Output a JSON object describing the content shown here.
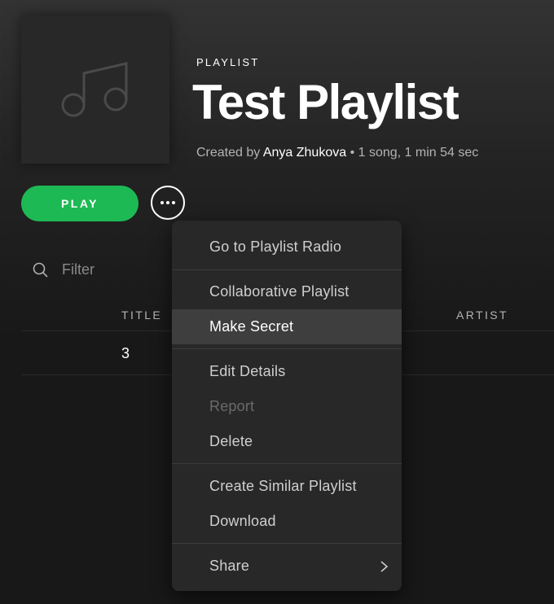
{
  "header": {
    "eyebrow": "PLAYLIST",
    "title": "Test Playlist",
    "created_by_prefix": "Created by",
    "owner": "Anya Zhukova",
    "separator": "•",
    "stats": "1 song, 1 min 54 sec",
    "cover_icon": "music-note-icon"
  },
  "actions": {
    "play_label": "PLAY",
    "more_icon": "more-options-icon"
  },
  "filter": {
    "placeholder": "Filter",
    "value": ""
  },
  "table": {
    "columns": [
      "TITLE",
      "ARTIST"
    ],
    "rows": [
      {
        "title": "3",
        "artist": ""
      }
    ]
  },
  "context_menu": {
    "groups": [
      [
        {
          "label": "Go to Playlist Radio"
        }
      ],
      [
        {
          "label": "Collaborative Playlist"
        },
        {
          "label": "Make Secret",
          "state": "hover"
        }
      ],
      [
        {
          "label": "Edit Details"
        },
        {
          "label": "Report",
          "state": "disabled"
        },
        {
          "label": "Delete"
        }
      ],
      [
        {
          "label": "Create Similar Playlist"
        },
        {
          "label": "Download"
        }
      ],
      [
        {
          "label": "Share",
          "submenu": true
        }
      ]
    ],
    "items": {
      "radio": "Go to Playlist Radio",
      "collaborative": "Collaborative Playlist",
      "make_secret": "Make Secret",
      "edit_details": "Edit Details",
      "report": "Report",
      "delete": "Delete",
      "create_similar": "Create Similar Playlist",
      "download": "Download",
      "share": "Share"
    }
  },
  "colors": {
    "accent": "#1db954",
    "background": "#181818",
    "menu_bg": "#282828",
    "menu_hover": "#3e3e3e"
  }
}
